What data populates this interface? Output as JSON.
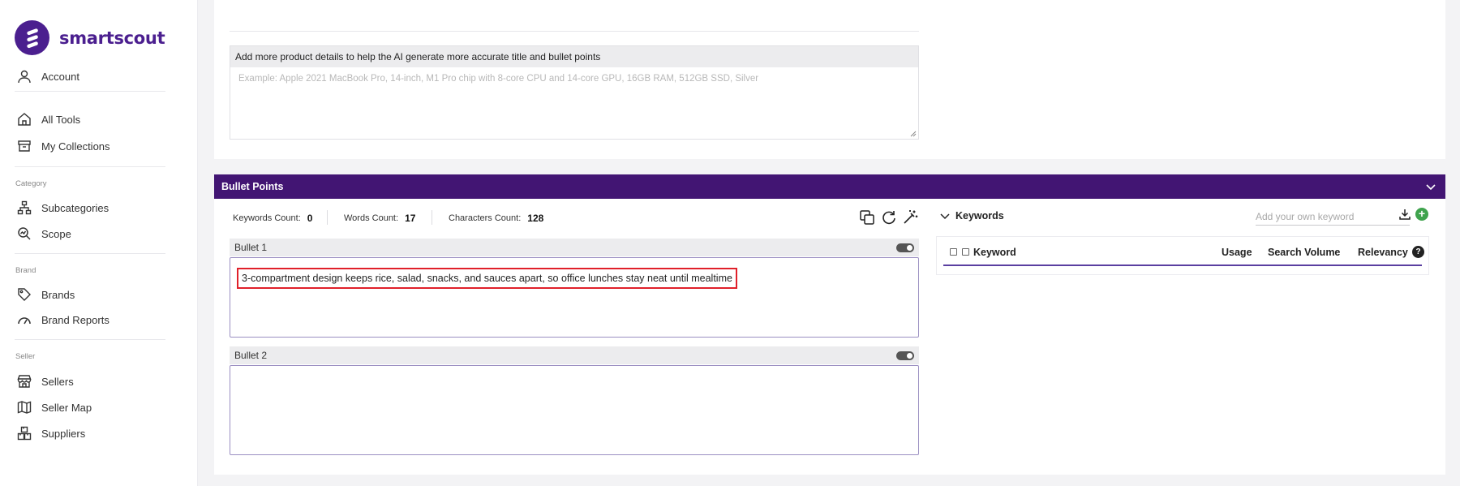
{
  "brand": {
    "name": "smartscout"
  },
  "sidebar": {
    "items": [
      {
        "label": "Account",
        "icon": "user-icon"
      },
      {
        "label": "All Tools",
        "icon": "home-icon"
      },
      {
        "label": "My Collections",
        "icon": "archive-icon"
      },
      {
        "label": "Subcategories",
        "icon": "hierarchy-icon"
      },
      {
        "label": "Scope",
        "icon": "magnify-chart-icon"
      },
      {
        "label": "Brands",
        "icon": "tag-icon"
      },
      {
        "label": "Brand Reports",
        "icon": "gauge-icon"
      },
      {
        "label": "Sellers",
        "icon": "store-icon"
      },
      {
        "label": "Seller Map",
        "icon": "map-icon"
      },
      {
        "label": "Suppliers",
        "icon": "boxes-icon"
      }
    ],
    "sections": {
      "category": "Category",
      "brand": "Brand",
      "seller": "Seller"
    }
  },
  "details": {
    "heading": "Add more product details to help the AI generate more accurate title and bullet points",
    "placeholder": "Example: Apple 2021 MacBook Pro, 14-inch, M1 Pro chip with 8-core CPU and 14-core GPU, 16GB RAM, 512GB SSD, Silver"
  },
  "bullet_points": {
    "title": "Bullet Points",
    "stats": {
      "keywords_label": "Keywords Count:",
      "keywords_value": "0",
      "words_label": "Words Count:",
      "words_value": "17",
      "chars_label": "Characters Count:",
      "chars_value": "128"
    },
    "bullets": [
      {
        "label": "Bullet 1",
        "text": "3-compartment design keeps rice, salad, snacks, and sauces apart, so office lunches stay neat until mealtime",
        "enabled": true
      },
      {
        "label": "Bullet 2",
        "text": "",
        "enabled": true
      }
    ]
  },
  "keywords": {
    "title": "Keywords",
    "input_placeholder": "Add your own keyword",
    "columns": {
      "keyword": "Keyword",
      "usage": "Usage",
      "search_volume": "Search Volume",
      "relevancy": "Relevancy"
    }
  },
  "colors": {
    "brand": "#4b1f8f",
    "header": "#421573",
    "highlight": "#e0202a",
    "add": "#3fa34d"
  }
}
